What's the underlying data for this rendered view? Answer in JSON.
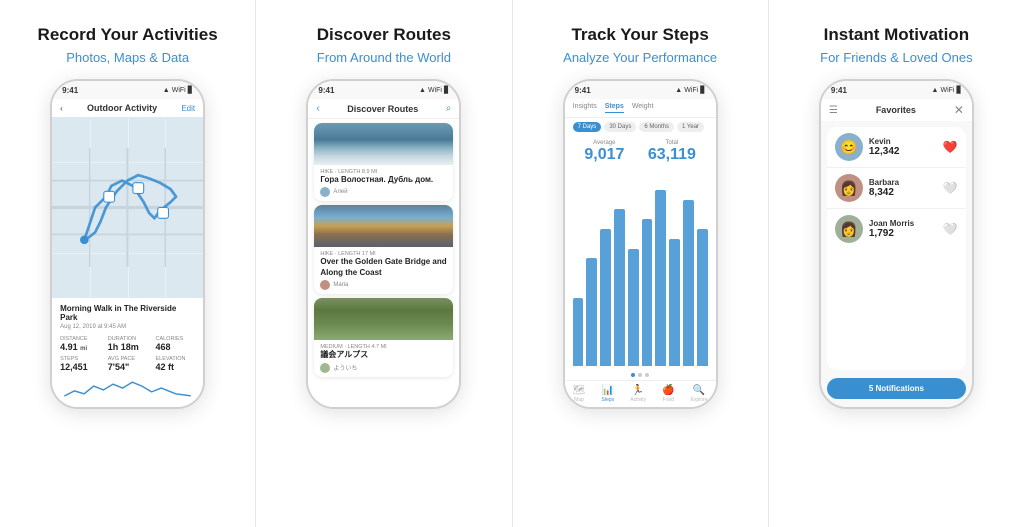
{
  "panels": [
    {
      "id": "panel-1",
      "title": "Record Your Activities",
      "subtitle": "Photos, Maps & Data",
      "phone": {
        "status_time": "9:41",
        "screen": "map",
        "map_header_title": "Outdoor Activity",
        "map_header_btn": "Edit",
        "activity_title": "Morning Walk in The Riverside Park",
        "activity_date": "Aug 12, 2019 at 9:45 AM",
        "stats": [
          {
            "label": "Distance",
            "value": "4.91",
            "unit": "mi"
          },
          {
            "label": "Duration",
            "value": "1h 18m",
            "unit": ""
          },
          {
            "label": "Calories",
            "value": "468",
            "unit": ""
          }
        ],
        "stats2": [
          {
            "label": "Steps",
            "value": "12,451",
            "unit": ""
          },
          {
            "label": "Avg Pace",
            "value": "7'54\"",
            "unit": ""
          },
          {
            "label": "Elevation Gain",
            "value": "42 ft",
            "unit": ""
          }
        ]
      }
    },
    {
      "id": "panel-2",
      "title": "Discover Routes",
      "subtitle": "From Around the World",
      "phone": {
        "status_time": "9:41",
        "screen": "routes",
        "header_title": "Discover Routes",
        "routes": [
          {
            "type": "Hike · Length 8.9 Mi",
            "name": "Гора Волостная. Дубль дом.",
            "username": "Алей",
            "img": "mountain"
          },
          {
            "type": "Hike · Length 17 Mi",
            "name": "Over the Golden Gate Bridge and Along the Coast",
            "username": "Maria",
            "img": "bridge"
          },
          {
            "type": "Medium · Length 4.7 Mi",
            "name": "議会アルプス",
            "username": "よういち",
            "img": "forest"
          }
        ]
      }
    },
    {
      "id": "panel-3",
      "title": "Track Your Steps",
      "subtitle": "Analyze Your Performance",
      "phone": {
        "status_time": "9:41",
        "screen": "steps",
        "tabs": [
          "Insights",
          "Steps",
          "Weight"
        ],
        "active_tab": "Steps",
        "periods": [
          "7 Days",
          "30 Days",
          "6 Months",
          "1 Year"
        ],
        "active_period": "7 Days",
        "average_label": "Average",
        "average_value": "9,017",
        "total_label": "Total",
        "total_value": "63,119",
        "bars": [
          35,
          55,
          70,
          80,
          60,
          75,
          90,
          65,
          85,
          70
        ],
        "nav_items": [
          "Map",
          "Steps",
          "Activity",
          "Food",
          "Explore"
        ]
      }
    },
    {
      "id": "panel-4",
      "title": "Instant Motivation",
      "subtitle": "For Friends & Loved Ones",
      "phone": {
        "status_time": "9:41",
        "screen": "motivation",
        "header_title": "Favorites",
        "friends": [
          {
            "name": "Kevin",
            "steps": "12,342",
            "emoji": "😊",
            "heart": "❤️"
          },
          {
            "name": "Barbara",
            "steps": "8,342",
            "emoji": "👩",
            "heart": "🤍"
          },
          {
            "name": "Joan Morris",
            "steps": "1,792",
            "emoji": "👩",
            "heart": "🤍"
          }
        ],
        "notif_btn": "5 Notifications"
      }
    }
  ]
}
